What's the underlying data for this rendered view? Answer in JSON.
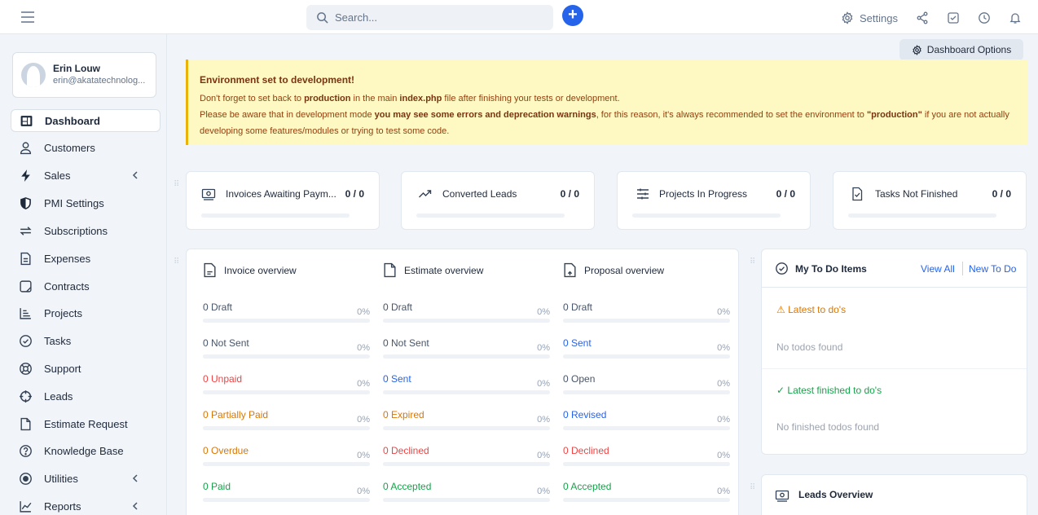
{
  "header": {
    "search_placeholder": "Search...",
    "add_label": "+",
    "settings_label": "Settings"
  },
  "user": {
    "name": "Erin Louw",
    "email": "erin@akatatechnolog..."
  },
  "sidebar": {
    "items": [
      {
        "label": "Dashboard",
        "icon": "dashboard-icon"
      },
      {
        "label": "Customers",
        "icon": "user-icon"
      },
      {
        "label": "Sales",
        "icon": "bolt-icon"
      },
      {
        "label": "PMI Settings",
        "icon": "shield-icon"
      },
      {
        "label": "Subscriptions",
        "icon": "repeat-icon"
      },
      {
        "label": "Expenses",
        "icon": "file-text-icon"
      },
      {
        "label": "Contracts",
        "icon": "contract-icon"
      },
      {
        "label": "Projects",
        "icon": "projects-icon"
      },
      {
        "label": "Tasks",
        "icon": "check-circle-icon"
      },
      {
        "label": "Support",
        "icon": "lifebuoy-icon"
      },
      {
        "label": "Leads",
        "icon": "target-icon"
      },
      {
        "label": "Estimate Request",
        "icon": "file-icon"
      },
      {
        "label": "Knowledge Base",
        "icon": "question-circle-icon"
      },
      {
        "label": "Utilities",
        "icon": "radio-icon"
      },
      {
        "label": "Reports",
        "icon": "chart-line-icon"
      }
    ]
  },
  "main": {
    "dashboard_options": "Dashboard Options",
    "alert": {
      "title": "Environment set to development!",
      "line1_a": "Don't forget to set back to ",
      "line1_b": "production",
      "line1_c": " in the main ",
      "line1_d": "index.php",
      "line1_e": " file after finishing your tests or development.",
      "line2_a": "Please be aware that in development mode ",
      "line2_b": "you may see some errors and deprecation warnings",
      "line2_c": ", for this reason, it's always recommended to set the environment to ",
      "line2_d": "\"production\"",
      "line2_e": " if you are not actually developing some features/modules or trying to test some code."
    },
    "stats": [
      {
        "label": "Invoices Awaiting Paym...",
        "value": "0 / 0",
        "icon": "invoice-icon"
      },
      {
        "label": "Converted Leads",
        "value": "0 / 0",
        "icon": "trending-up-icon"
      },
      {
        "label": "Projects In Progress",
        "value": "0 / 0",
        "icon": "sliders-icon"
      },
      {
        "label": "Tasks Not Finished",
        "value": "0 / 0",
        "icon": "task-icon"
      }
    ],
    "overviews": [
      {
        "title": "Invoice overview",
        "rows": [
          {
            "label": "0 Draft",
            "pct": "0%",
            "color": "#475569"
          },
          {
            "label": "0 Not Sent",
            "pct": "0%",
            "color": "#475569"
          },
          {
            "label": "0 Unpaid",
            "pct": "0%",
            "color": "#ef4444"
          },
          {
            "label": "0 Partially Paid",
            "pct": "0%",
            "color": "#d97706"
          },
          {
            "label": "0 Overdue",
            "pct": "0%",
            "color": "#d97706"
          },
          {
            "label": "0 Paid",
            "pct": "0%",
            "color": "#16a34a"
          }
        ]
      },
      {
        "title": "Estimate overview",
        "rows": [
          {
            "label": "0 Draft",
            "pct": "0%",
            "color": "#475569"
          },
          {
            "label": "0 Not Sent",
            "pct": "0%",
            "color": "#475569"
          },
          {
            "label": "0 Sent",
            "pct": "0%",
            "color": "#2563eb"
          },
          {
            "label": "0 Expired",
            "pct": "0%",
            "color": "#d97706"
          },
          {
            "label": "0 Declined",
            "pct": "0%",
            "color": "#ef4444"
          },
          {
            "label": "0 Accepted",
            "pct": "0%",
            "color": "#16a34a"
          }
        ]
      },
      {
        "title": "Proposal overview",
        "rows": [
          {
            "label": "0 Draft",
            "pct": "0%",
            "color": "#475569"
          },
          {
            "label": "0 Sent",
            "pct": "0%",
            "color": "#2563eb"
          },
          {
            "label": "0 Open",
            "pct": "0%",
            "color": "#475569"
          },
          {
            "label": "0 Revised",
            "pct": "0%",
            "color": "#2563eb"
          },
          {
            "label": "0 Declined",
            "pct": "0%",
            "color": "#ef4444"
          },
          {
            "label": "0 Accepted",
            "pct": "0%",
            "color": "#16a34a"
          }
        ]
      }
    ],
    "todo": {
      "title": "My To Do Items",
      "view_all": "View All",
      "new_todo": "New To Do",
      "latest": "Latest to do's",
      "no_todos": "No todos found",
      "latest_finished": "Latest finished to do's",
      "no_finished": "No finished todos found"
    },
    "leads": {
      "title": "Leads Overview"
    }
  }
}
